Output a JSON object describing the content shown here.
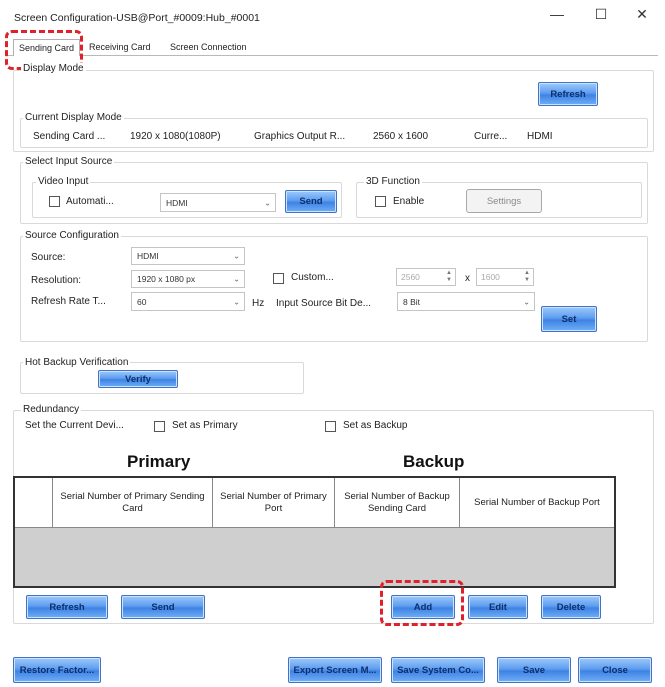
{
  "window": {
    "title": "Screen Configuration-USB@Port_#0009:Hub_#0001",
    "controls": {
      "minimize": "—",
      "maximize": "☐",
      "close": "✕"
    }
  },
  "tabs": [
    "Sending Card",
    "Receiving Card",
    "Screen Connection"
  ],
  "display_mode": {
    "label": "Display Mode",
    "refresh": "Refresh",
    "current_label": "Current Display Mode",
    "sending_card_label": "Sending Card ...",
    "sending_card_value": "1920 x 1080(1080P)",
    "graphics_label": "Graphics Output R...",
    "graphics_value": "2560 x 1600",
    "current_short_label": "Curre...",
    "current_short_value": "HDMI"
  },
  "input_source": {
    "label": "Select Input Source",
    "video_input_label": "Video Input",
    "automatic_label": "Automati...",
    "video_select": "HDMI",
    "send": "Send",
    "function_3d_label": "3D Function",
    "enable_label": "Enable",
    "settings": "Settings"
  },
  "source_config": {
    "label": "Source Configuration",
    "source_label": "Source:",
    "source_value": "HDMI",
    "resolution_label": "Resolution:",
    "resolution_value": "1920 x 1080 px",
    "custom_label": "Custom...",
    "width_value": "2560",
    "x_sep": "x",
    "height_value": "1600",
    "refresh_rate_label": "Refresh Rate T...",
    "refresh_rate_value": "60",
    "hz": "Hz",
    "bit_depth_label": "Input Source Bit De...",
    "bit_depth_value": "8 Bit",
    "set": "Set"
  },
  "hot_backup": {
    "label": "Hot Backup Verification",
    "verify": "Verify"
  },
  "redundancy": {
    "label": "Redundancy",
    "set_current_label": "Set the Current Devi...",
    "set_primary": "Set as Primary",
    "set_backup": "Set as Backup",
    "primary_heading": "Primary",
    "backup_heading": "Backup",
    "columns": [
      "Serial Number of Primary Sending Card",
      "Serial Number of Primary Port",
      "Serial Number of Backup Sending Card",
      "Serial Number of Backup Port"
    ],
    "rows": [],
    "buttons": {
      "refresh": "Refresh",
      "send": "Send",
      "add": "Add",
      "edit": "Edit",
      "delete": "Delete"
    }
  },
  "footer": {
    "restore": "Restore Factor...",
    "export": "Export Screen M...",
    "save_system": "Save System Co...",
    "save": "Save",
    "close": "Close"
  }
}
